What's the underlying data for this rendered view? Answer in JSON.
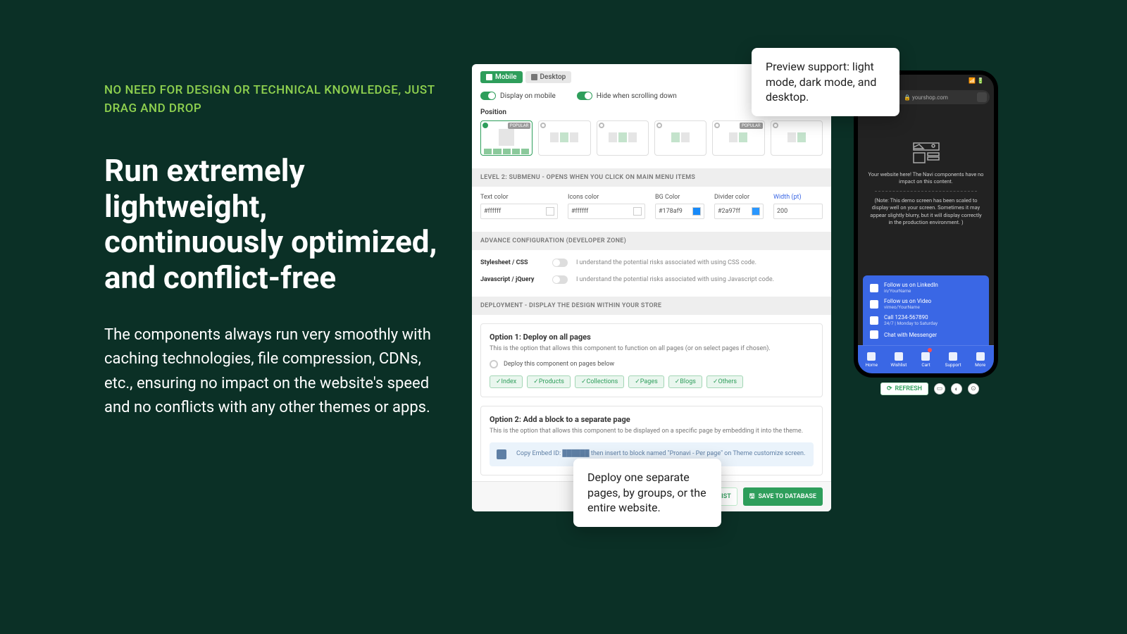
{
  "left": {
    "eyebrow": "NO NEED FOR DESIGN OR TECHNICAL KNOWLEDGE, JUST DRAG AND DROP",
    "headline": "Run extremely lightweight, continuously optimized, and conflict-free",
    "body": "The components always run very smoothly with caching technologies, file compression, CDNs, etc., ensuring no impact on the website's speed and no conflicts with any other themes or apps."
  },
  "panel": {
    "tabs": {
      "mobile": "Mobile",
      "desktop": "Desktop"
    },
    "toggles": {
      "display_mobile": "Display on mobile",
      "hide_scroll": "Hide when scrolling down"
    },
    "position_label": "Position",
    "popular": "POPULAR",
    "section_level2": "LEVEL 2: SUBMENU - OPENS WHEN YOU CLICK ON MAIN MENU ITEMS",
    "colors": {
      "text_color": {
        "label": "Text color",
        "value": "#ffffff"
      },
      "icons_color": {
        "label": "Icons color",
        "value": "#ffffff"
      },
      "bg_color": {
        "label": "BG Color",
        "value": "#178af9"
      },
      "divider_color": {
        "label": "Divider color",
        "value": "#2a97ff"
      },
      "width": {
        "label": "Width (pt)",
        "value": "200"
      }
    },
    "section_adv": "ADVANCE CONFIGURATION (DEVELOPER ZONE)",
    "adv": {
      "css": {
        "label": "Stylesheet / CSS",
        "note": "I understand the potential risks associated with using CSS code."
      },
      "js": {
        "label": "Javascript / jQuery",
        "note": "I understand the potential risks associated with using Javascript code."
      }
    },
    "section_deploy": "DEPLOYMENT - DISPLAY THE DESIGN WITHIN YOUR STORE",
    "opt1": {
      "title": "Option 1: Deploy on all pages",
      "desc": "This is the option that allows this component to function on all pages (or on select pages if chosen).",
      "check_label": "Deploy this component on pages below",
      "chips": [
        "✓Index",
        "✓Products",
        "✓Collections",
        "✓Pages",
        "✓Blogs",
        "✓Others"
      ]
    },
    "opt2": {
      "title": "Option 2: Add a block to a separate page",
      "desc": "This is the option that allows this component to be displayed on a specific page by embedding it into the theme.",
      "embed": "Copy Embed ID: ██████ then insert to block named \"Pronavi - Per page\" on Theme customize screen."
    },
    "footer": {
      "back": "BACK TO LIST",
      "save": "SAVE TO DATABASE"
    }
  },
  "phone": {
    "url": "yourshop.com",
    "hero1": "Your website here! The Navi components have no impact on this content.",
    "hero2": "(Note: This demo screen has been scaled to display well on your screen. Sometimes it may appear slightly blurry, but it will display correctly in the production environment. )",
    "socials": [
      {
        "t": "Follow us on LinkedIn",
        "s": "in/YourName"
      },
      {
        "t": "Follow us on Video",
        "s": "vimeo/YourName"
      },
      {
        "t": "Call 1234-567890",
        "s": "24/7 | Monday to Saturday"
      },
      {
        "t": "Chat with Messenger",
        "s": ""
      }
    ],
    "tabs": [
      "Home",
      "Wishlist",
      "Cart",
      "Support",
      "More"
    ]
  },
  "preview_controls": {
    "refresh": "REFRESH"
  },
  "callouts": {
    "c1": "Preview support: light mode, dark mode, and desktop.",
    "c2": "Deploy one separate pages, by groups, or the entire website."
  }
}
